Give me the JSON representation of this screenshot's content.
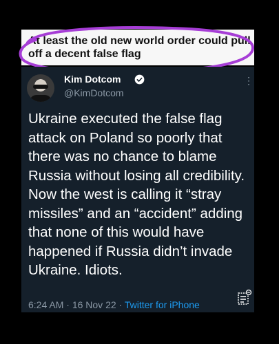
{
  "caption": {
    "text": "At least the old new world order could pull off a decent false flag"
  },
  "tweet": {
    "display_name": "Kim Dotcom",
    "handle": "@KimDotcom",
    "body": "Ukraine executed the false flag attack on Poland so poorly that there was no chance to blame Russia without losing all credibility. Now the west is calling it “stray missiles” and an “accident” adding that none of this would have happened if Russia didn’t invade Ukraine. Idiots.",
    "time": "6:24 AM",
    "date": "16 Nov 22",
    "source": "Twitter for iPhone",
    "separator": " · "
  },
  "colors": {
    "highlight_circle": "#a63dd6",
    "tweet_background": "#15202b",
    "link_blue": "#1d9bf0",
    "muted_text": "#8b98a5"
  },
  "icons": [
    "verified-badge-icon",
    "more-options-icon",
    "analytics-icon"
  ]
}
